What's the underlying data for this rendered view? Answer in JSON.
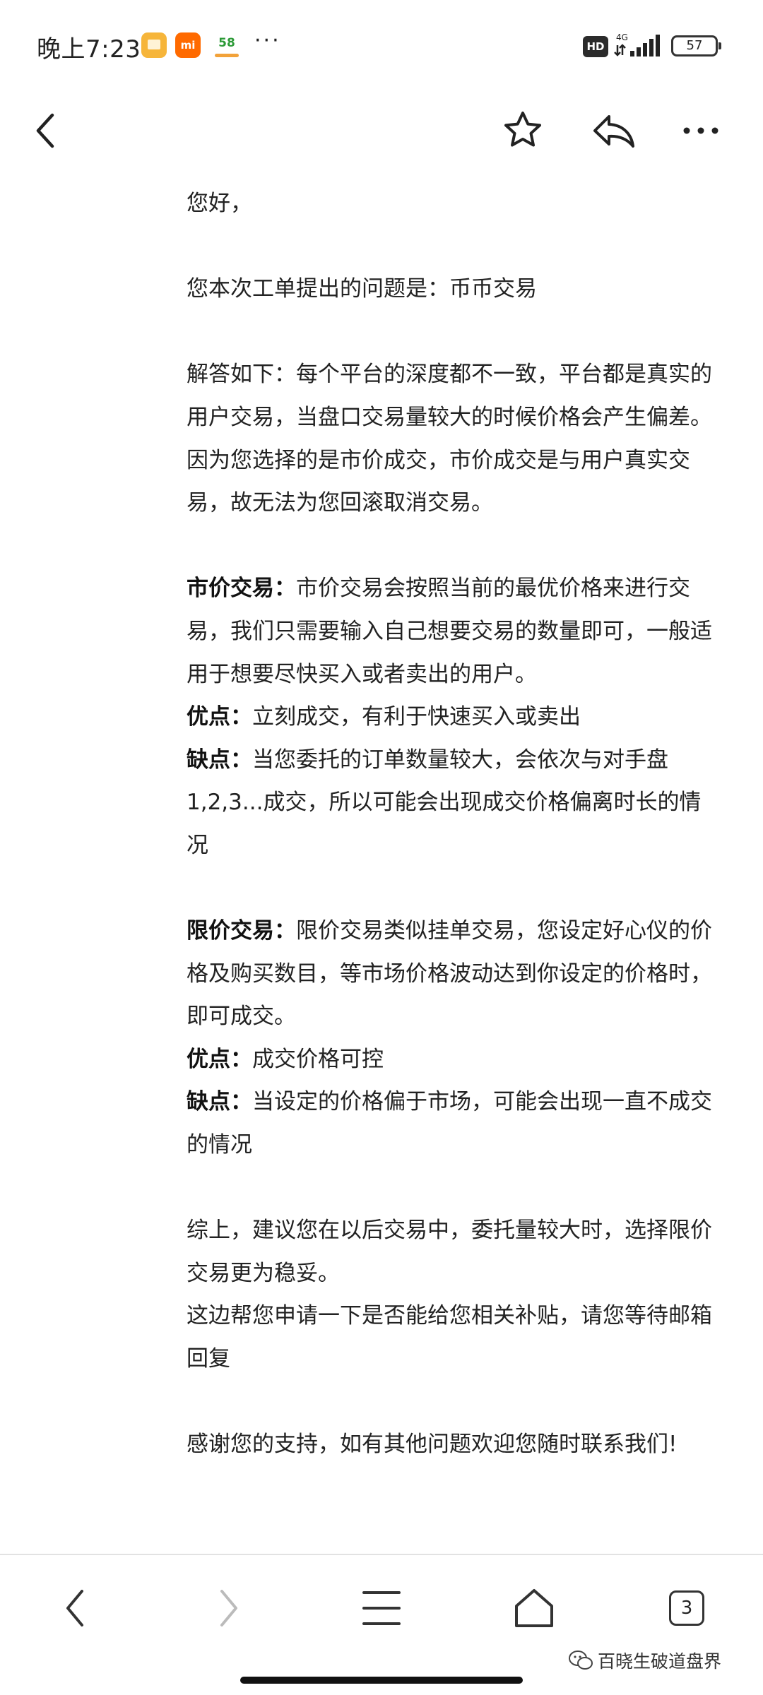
{
  "status_bar": {
    "time": "晚上7:23",
    "app_58": "58",
    "more_dots": "···",
    "hd": "HD",
    "network": "4G",
    "battery": "57"
  },
  "toolbar": {
    "back_icon": "chevron-left-icon",
    "favorite_icon": "star-outline-icon",
    "reply_icon": "reply-arrow-icon",
    "more_icon": "more-horizontal-icon"
  },
  "message": {
    "greeting": "您好，",
    "issue": "您本次工单提出的问题是：币币交易",
    "answer_1": "解答如下：每个平台的深度都不一致，平台都是真实的用户交易，当盘口交易量较大的时候价格会产生偏差。",
    "answer_2": "因为您选择的是市价成交，市价成交是与用户真实交易，故无法为您回滚取消交易。",
    "market": {
      "label": "市价交易：",
      "text": "市价交易会按照当前的最优价格来进行交易，我们只需要输入自己想要交易的数量即可，一般适用于想要尽快买入或者卖出的用户。",
      "pros_label": "优点：",
      "pros_text": "立刻成交，有利于快速买入或卖出",
      "cons_label": "缺点：",
      "cons_text": "当您委托的订单数量较大，会依次与对手盘1,2,3...成交，所以可能会出现成交价格偏离时长的情况"
    },
    "limit": {
      "label": "限价交易：",
      "text": "限价交易类似挂单交易，您设定好心仪的价格及购买数目，等市场价格波动达到你设定的价格时，即可成交。",
      "pros_label": "优点：",
      "pros_text": "成交价格可控",
      "cons_label": "缺点：",
      "cons_text": "当设定的价格偏于市场，可能会出现一直不成交的情况"
    },
    "summary_1": "综上，建议您在以后交易中，委托量较大时，选择限价交易更为稳妥。",
    "summary_2": "这边帮您申请一下是否能给您相关补贴，请您等待邮箱回复",
    "closing": "感谢您的支持，如有其他问题欢迎您随时联系我们!"
  },
  "bottom_nav": {
    "back_icon": "chevron-left-icon",
    "forward_icon": "chevron-right-icon",
    "menu_icon": "menu-icon",
    "home_icon": "home-icon",
    "tab_count": "3"
  },
  "watermark": {
    "text": "百晓生破道盘界",
    "icon": "wechat-icon"
  },
  "colors": {
    "text": "#222222",
    "background": "#ffffff",
    "disabled_icon": "#bbbbbb"
  }
}
